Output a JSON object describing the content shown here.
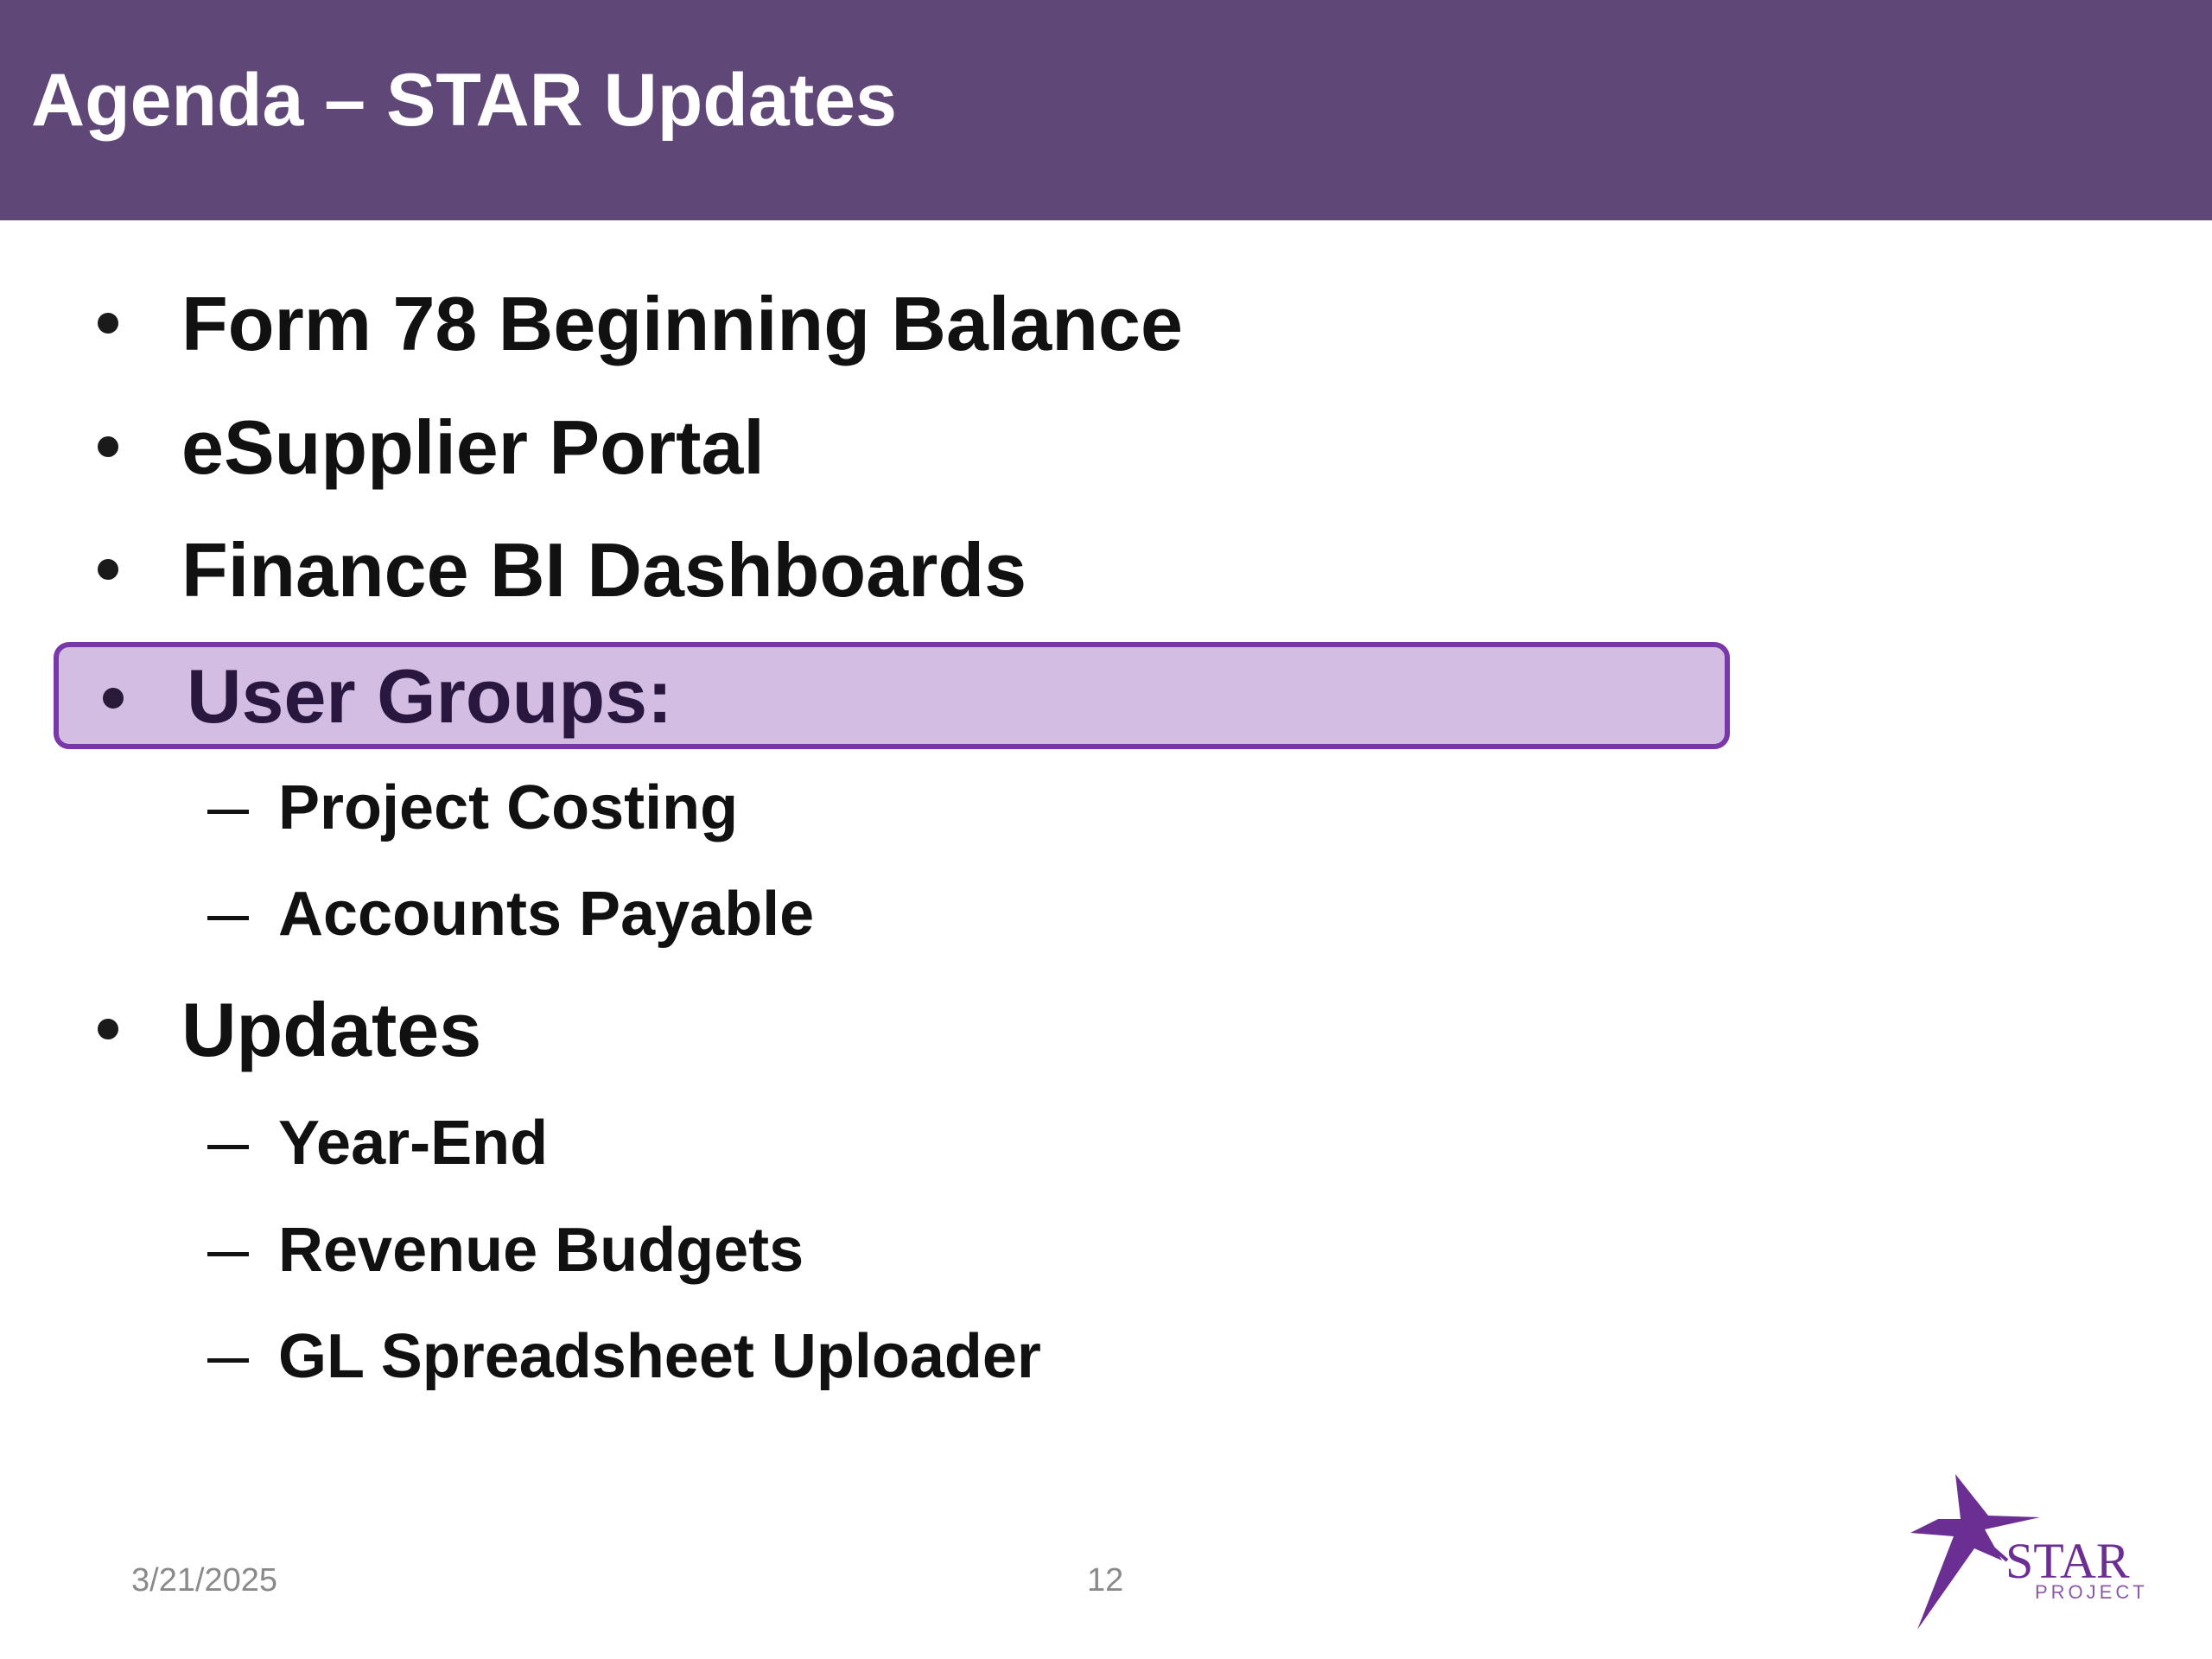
{
  "slide": {
    "title": "Agenda – STAR Updates",
    "header_color": "#5f4878",
    "highlight_color": "#d3bde2",
    "highlight_border_color": "#7a37a8"
  },
  "items": [
    {
      "label": "Form 78 Beginning Balance"
    },
    {
      "label": "eSupplier Portal"
    },
    {
      "label": "Finance BI Dashboards"
    },
    {
      "label": "User Groups:",
      "highlighted": true,
      "subitems": [
        "Project Costing",
        "Accounts Payable"
      ]
    },
    {
      "label": "Updates",
      "subitems": [
        "Year-End",
        "Revenue Budgets",
        "GL Spreadsheet Uploader"
      ]
    }
  ],
  "footer": {
    "date": "3/21/2025",
    "page_number": "12"
  },
  "logo": {
    "icon": "star-project-logo",
    "text": "STAR",
    "subtext": "PROJECT"
  }
}
